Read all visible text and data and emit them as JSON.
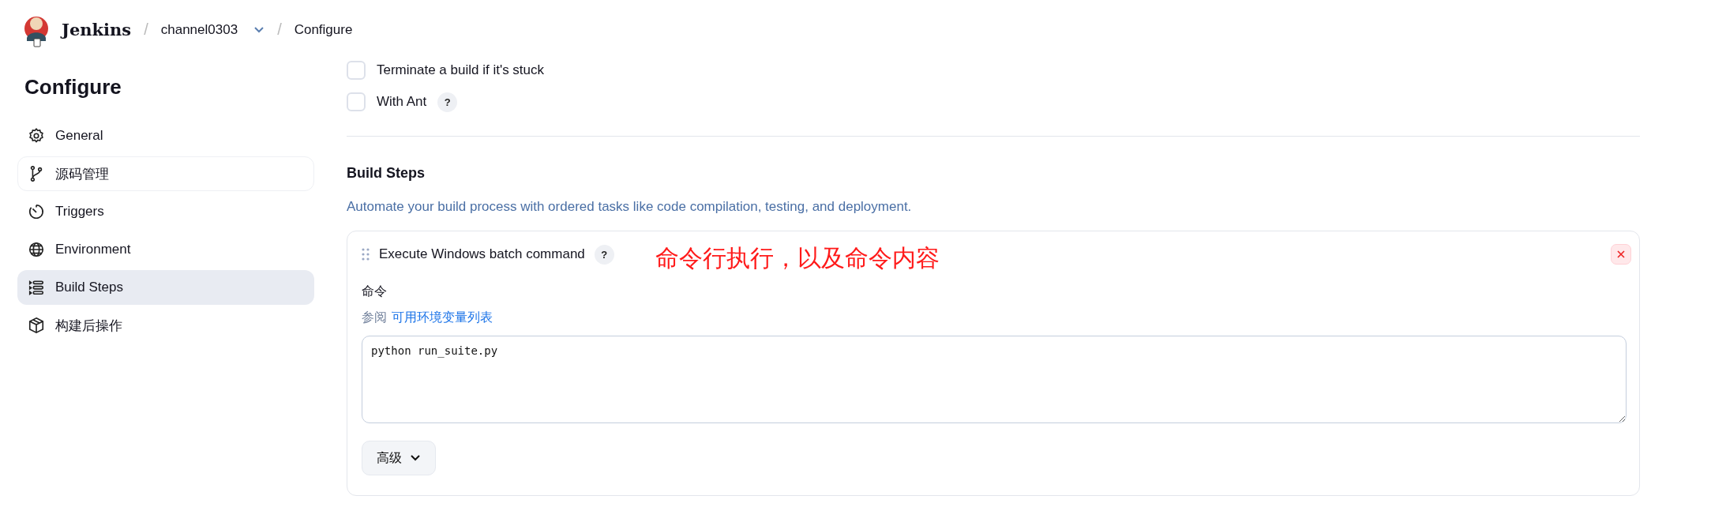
{
  "breadcrumb": {
    "app": "Jenkins",
    "separator_1": "/",
    "job": "channel0303",
    "separator_2": "/",
    "page": "Configure"
  },
  "sidebar": {
    "title": "Configure",
    "items": [
      {
        "label": "General",
        "selected": false,
        "hovered": false
      },
      {
        "label": "源码管理",
        "selected": false,
        "hovered": true
      },
      {
        "label": "Triggers",
        "selected": false,
        "hovered": false
      },
      {
        "label": "Environment",
        "selected": false,
        "hovered": false
      },
      {
        "label": "Build Steps",
        "selected": true,
        "hovered": false
      },
      {
        "label": "构建后操作",
        "selected": false,
        "hovered": false
      }
    ]
  },
  "options": [
    {
      "label": "Terminate a build if it's stuck",
      "checked": false,
      "help": false
    },
    {
      "label": "With Ant",
      "checked": false,
      "help": true
    }
  ],
  "section": {
    "title": "Build Steps",
    "description": "Automate your build process with ordered tasks like code compilation, testing, and deployment.",
    "step": {
      "title": "Execute Windows batch command",
      "help": "?",
      "annotation": "命令行执行，以及命令内容",
      "field_label": "命令",
      "hint": "参阅",
      "hint_link": "可用环境变量列表",
      "command": "python run_suite.py",
      "advanced": "高级"
    }
  }
}
